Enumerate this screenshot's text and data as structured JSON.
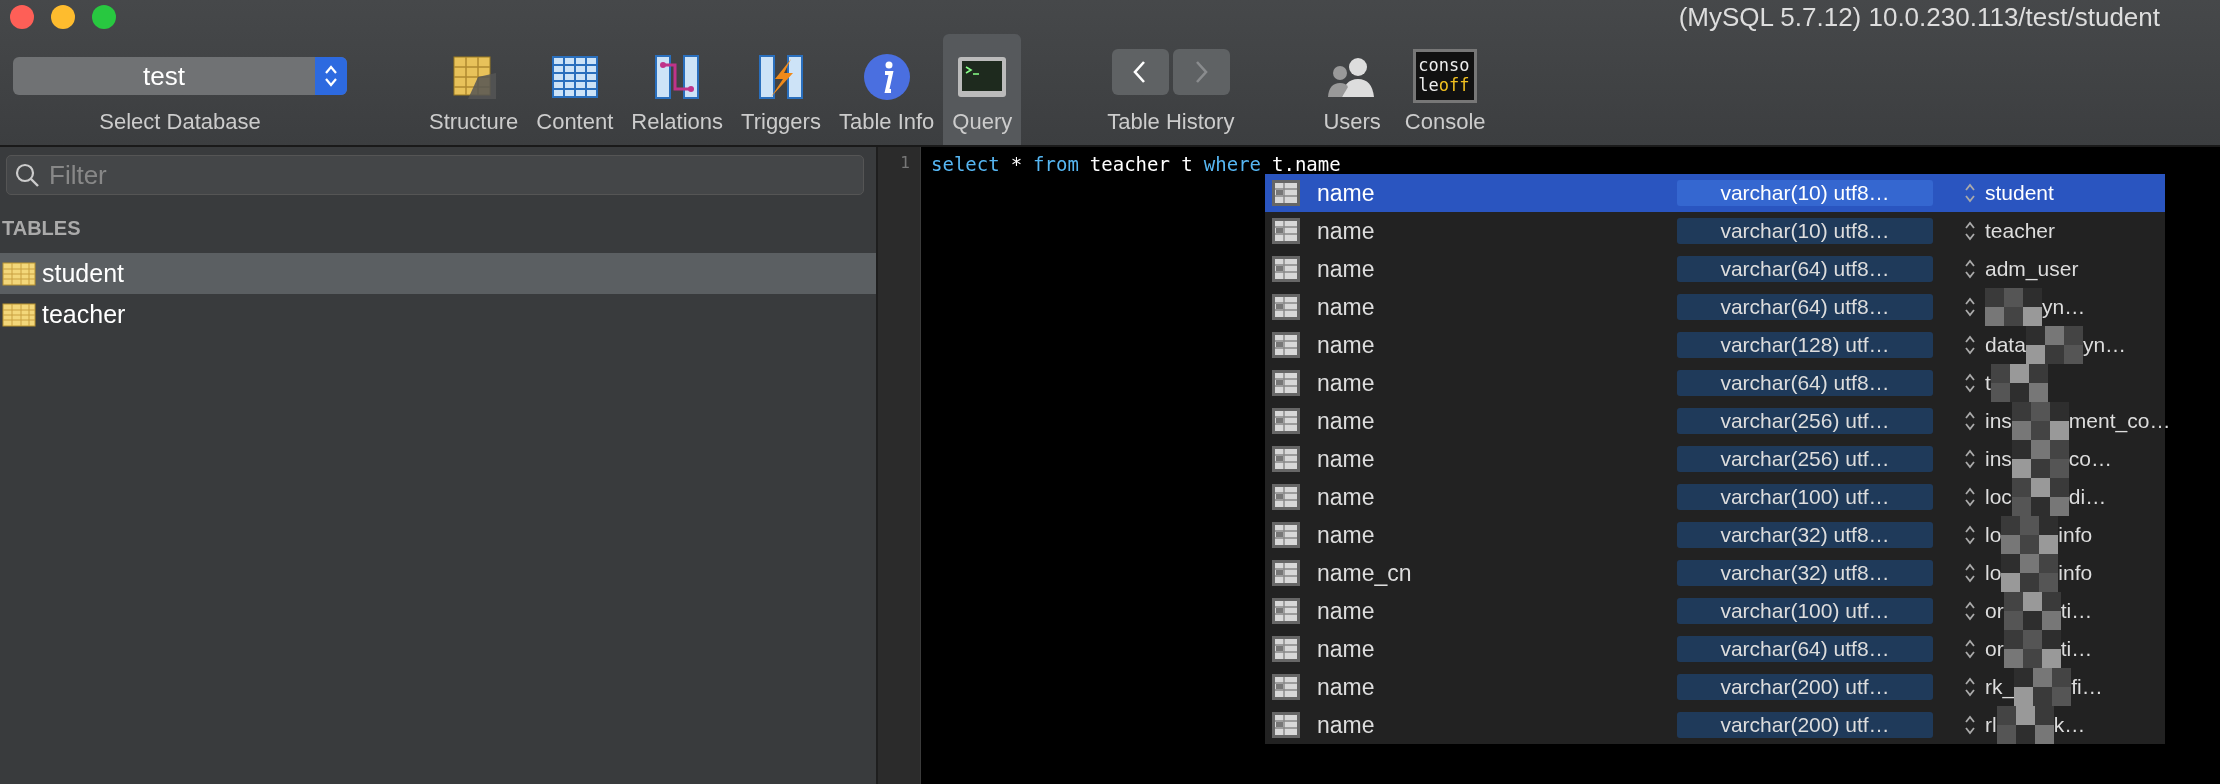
{
  "window": {
    "title": "(MySQL 5.7.12) 10.0.230.113/test/student"
  },
  "database_selector": {
    "value": "test",
    "label": "Select Database"
  },
  "toolbar": {
    "items": [
      {
        "kind": "structure",
        "label": "Structure",
        "selected": false
      },
      {
        "kind": "content",
        "label": "Content",
        "selected": false
      },
      {
        "kind": "relations",
        "label": "Relations",
        "selected": false
      },
      {
        "kind": "triggers",
        "label": "Triggers",
        "selected": false
      },
      {
        "kind": "info",
        "label": "Table Info",
        "selected": false
      },
      {
        "kind": "query",
        "label": "Query",
        "selected": true
      }
    ],
    "history": {
      "label": "Table History",
      "back_disabled": false,
      "forward_disabled": true
    },
    "extras": [
      {
        "kind": "users",
        "label": "Users"
      },
      {
        "kind": "console",
        "label": "Console",
        "badge_top": "conso",
        "badge_bottom": "le",
        "badge_state": "off"
      }
    ]
  },
  "sidebar": {
    "filter": {
      "placeholder": "Filter"
    },
    "section": "TABLES",
    "tables": [
      {
        "name": "student",
        "selected": true
      },
      {
        "name": "teacher",
        "selected": false
      }
    ]
  },
  "editor": {
    "line_numbers": [
      "1"
    ],
    "tokens": [
      {
        "kind": "keyword",
        "text": "select"
      },
      {
        "kind": "plain",
        "text": "*"
      },
      {
        "kind": "keyword",
        "text": "from"
      },
      {
        "kind": "plain",
        "text": "teacher t"
      },
      {
        "kind": "keyword",
        "text": "where"
      },
      {
        "kind": "plain",
        "text": "t.name"
      }
    ],
    "autocomplete": [
      {
        "name": "name",
        "type": "varchar(10) utf8…",
        "table_parts": [
          {
            "kind": "text",
            "text": "student"
          }
        ],
        "selected": true
      },
      {
        "name": "name",
        "type": "varchar(10) utf8…",
        "table_parts": [
          {
            "kind": "text",
            "text": "teacher"
          }
        ],
        "selected": false
      },
      {
        "name": "name",
        "type": "varchar(64) utf8…",
        "table_parts": [
          {
            "kind": "text",
            "text": "adm_user"
          }
        ],
        "selected": false
      },
      {
        "name": "name",
        "type": "varchar(64) utf8…",
        "table_parts": [
          {
            "kind": "redaction"
          },
          {
            "kind": "text",
            "text": "yn…"
          }
        ],
        "selected": false
      },
      {
        "name": "name",
        "type": "varchar(128) utf…",
        "table_parts": [
          {
            "kind": "text",
            "text": "data"
          },
          {
            "kind": "redaction"
          },
          {
            "kind": "text",
            "text": "yn…"
          }
        ],
        "selected": false
      },
      {
        "name": "name",
        "type": "varchar(64) utf8…",
        "table_parts": [
          {
            "kind": "text",
            "text": "t"
          },
          {
            "kind": "redaction"
          }
        ],
        "selected": false
      },
      {
        "name": "name",
        "type": "varchar(256) utf…",
        "table_parts": [
          {
            "kind": "text",
            "text": "ins"
          },
          {
            "kind": "redaction"
          },
          {
            "kind": "text",
            "text": "ment_co…"
          }
        ],
        "selected": false
      },
      {
        "name": "name",
        "type": "varchar(256) utf…",
        "table_parts": [
          {
            "kind": "text",
            "text": "ins"
          },
          {
            "kind": "redaction"
          },
          {
            "kind": "text",
            "text": "co…"
          }
        ],
        "selected": false
      },
      {
        "name": "name",
        "type": "varchar(100) utf…",
        "table_parts": [
          {
            "kind": "text",
            "text": "loc"
          },
          {
            "kind": "redaction"
          },
          {
            "kind": "text",
            "text": "di…"
          }
        ],
        "selected": false
      },
      {
        "name": "name",
        "type": "varchar(32) utf8…",
        "table_parts": [
          {
            "kind": "text",
            "text": "lo"
          },
          {
            "kind": "redaction"
          },
          {
            "kind": "text",
            "text": "info"
          }
        ],
        "selected": false
      },
      {
        "name": "name_cn",
        "type": "varchar(32) utf8…",
        "table_parts": [
          {
            "kind": "text",
            "text": "lo"
          },
          {
            "kind": "redaction"
          },
          {
            "kind": "text",
            "text": "info"
          }
        ],
        "selected": false
      },
      {
        "name": "name",
        "type": "varchar(100) utf…",
        "table_parts": [
          {
            "kind": "text",
            "text": "or"
          },
          {
            "kind": "redaction"
          },
          {
            "kind": "text",
            "text": "ti…"
          }
        ],
        "selected": false
      },
      {
        "name": "name",
        "type": "varchar(64) utf8…",
        "table_parts": [
          {
            "kind": "text",
            "text": "or"
          },
          {
            "kind": "redaction"
          },
          {
            "kind": "text",
            "text": "ti…"
          }
        ],
        "selected": false
      },
      {
        "name": "name",
        "type": "varchar(200) utf…",
        "table_parts": [
          {
            "kind": "text",
            "text": "rk_"
          },
          {
            "kind": "redaction"
          },
          {
            "kind": "text",
            "text": "fi…"
          }
        ],
        "selected": false
      },
      {
        "name": "name",
        "type": "varchar(200) utf…",
        "table_parts": [
          {
            "kind": "text",
            "text": "rl"
          },
          {
            "kind": "redaction"
          },
          {
            "kind": "text",
            "text": "k…"
          }
        ],
        "selected": false
      }
    ]
  }
}
